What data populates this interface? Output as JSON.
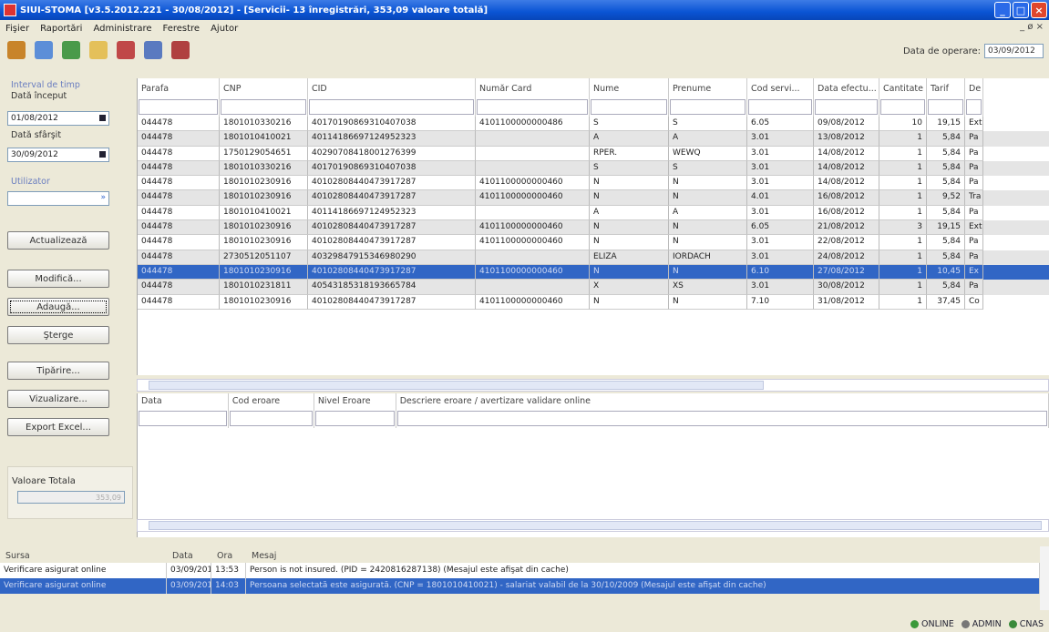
{
  "window": {
    "title": "SIUI-STOMA [v3.5.2012.221 - 30/08/2012] - [Servicii- 13 înregistrări, 353,09  valoare totală]"
  },
  "menu": [
    "Fişier",
    "Raportări",
    "Administrare",
    "Ferestre",
    "Ajutor"
  ],
  "mdi_controls": "_ ø ×",
  "toolbar": {
    "icons": [
      "users-icon",
      "arrows-icon",
      "upload-icon",
      "folder-icon",
      "document-icon",
      "print-icon",
      "export-icon"
    ]
  },
  "date_operare": {
    "label": "Data de operare:",
    "value": "03/09/2012"
  },
  "filters": {
    "interval_label": "Interval de timp",
    "start_label": "Dată început",
    "start_value": "01/08/2012",
    "end_label": "Dată sfârşit",
    "end_value": "30/09/2012",
    "user_label": "Utilizator",
    "user_value": ""
  },
  "buttons": {
    "refresh": "Actualizează",
    "modify": "Modifică...",
    "add": "Adaugă...",
    "delete": "Şterge",
    "print": "Tipărire...",
    "view": "Vizualizare...",
    "export": "Export Excel..."
  },
  "total": {
    "label": "Valoare Totala",
    "value": "353,09"
  },
  "grid": {
    "columns": [
      "Parafa",
      "CNP",
      "CID",
      "Număr Card",
      "Nume",
      "Prenume",
      "Cod servi...",
      "Data efectu...",
      "Cantitate",
      "Tarif",
      "De"
    ],
    "rows": [
      [
        "044478",
        "1801010330216",
        "40170190869310407038",
        "4101100000000486",
        "S",
        "S",
        "6.05",
        "09/08/2012",
        "10",
        "19,15",
        "Ext"
      ],
      [
        "044478",
        "1801010410021",
        "40114186697124952323",
        "",
        "A",
        "A",
        "3.01",
        "13/08/2012",
        "1",
        "5,84",
        "Pa"
      ],
      [
        "044478",
        "1750129054651",
        "40290708418001276399",
        "",
        "RPER.",
        "WEWQ",
        "3.01",
        "14/08/2012",
        "1",
        "5,84",
        "Pa"
      ],
      [
        "044478",
        "1801010330216",
        "40170190869310407038",
        "",
        "S",
        "S",
        "3.01",
        "14/08/2012",
        "1",
        "5,84",
        "Pa"
      ],
      [
        "044478",
        "1801010230916",
        "40102808440473917287",
        "4101100000000460",
        "N",
        "N",
        "3.01",
        "14/08/2012",
        "1",
        "5,84",
        "Pa"
      ],
      [
        "044478",
        "1801010230916",
        "40102808440473917287",
        "4101100000000460",
        "N",
        "N",
        "4.01",
        "16/08/2012",
        "1",
        "9,52",
        "Tra"
      ],
      [
        "044478",
        "1801010410021",
        "40114186697124952323",
        "",
        "A",
        "A",
        "3.01",
        "16/08/2012",
        "1",
        "5,84",
        "Pa"
      ],
      [
        "044478",
        "1801010230916",
        "40102808440473917287",
        "4101100000000460",
        "N",
        "N",
        "6.05",
        "21/08/2012",
        "3",
        "19,15",
        "Ext"
      ],
      [
        "044478",
        "1801010230916",
        "40102808440473917287",
        "4101100000000460",
        "N",
        "N",
        "3.01",
        "22/08/2012",
        "1",
        "5,84",
        "Pa"
      ],
      [
        "044478",
        "2730512051107",
        "40329847915346980290",
        "",
        "ELIZA",
        "IORDACH",
        "3.01",
        "24/08/2012",
        "1",
        "5,84",
        "Pa"
      ],
      [
        "044478",
        "1801010230916",
        "40102808440473917287",
        "4101100000000460",
        "N",
        "N",
        "6.10",
        "27/08/2012",
        "1",
        "10,45",
        "Ex"
      ],
      [
        "044478",
        "1801010231811",
        "40543185318193665784",
        "",
        "X",
        "XS",
        "3.01",
        "30/08/2012",
        "1",
        "5,84",
        "Pa"
      ],
      [
        "044478",
        "1801010230916",
        "40102808440473917287",
        "4101100000000460",
        "N",
        "N",
        "7.10",
        "31/08/2012",
        "1",
        "37,45",
        "Co"
      ]
    ],
    "selected_index": 10
  },
  "errors": {
    "columns": [
      "Data",
      "Cod eroare",
      "Nivel Eroare",
      "Descriere eroare / avertizare validare online"
    ]
  },
  "messages": {
    "columns": [
      "Sursa",
      "Data",
      "Ora",
      "Mesaj"
    ],
    "rows": [
      [
        "Verificare asigurat online",
        "03/09/2012",
        "13:53",
        "Person is not insured. (PID = 2420816287138) (Mesajul este afişat din cache)"
      ],
      [
        "Verificare asigurat online",
        "03/09/2012",
        "14:03",
        "Persoana selectată este asigurată. (CNP = 1801010410021) - salariat valabil de la 30/10/2009 (Mesajul este afişat din cache)"
      ]
    ],
    "selected_index": 1
  },
  "status": {
    "online": "ONLINE",
    "user": "ADMIN",
    "cnas": "CNAS"
  },
  "colors": {
    "selection": "#3166c5",
    "titlebar": "#0a54d4",
    "face": "#ece9d8"
  }
}
